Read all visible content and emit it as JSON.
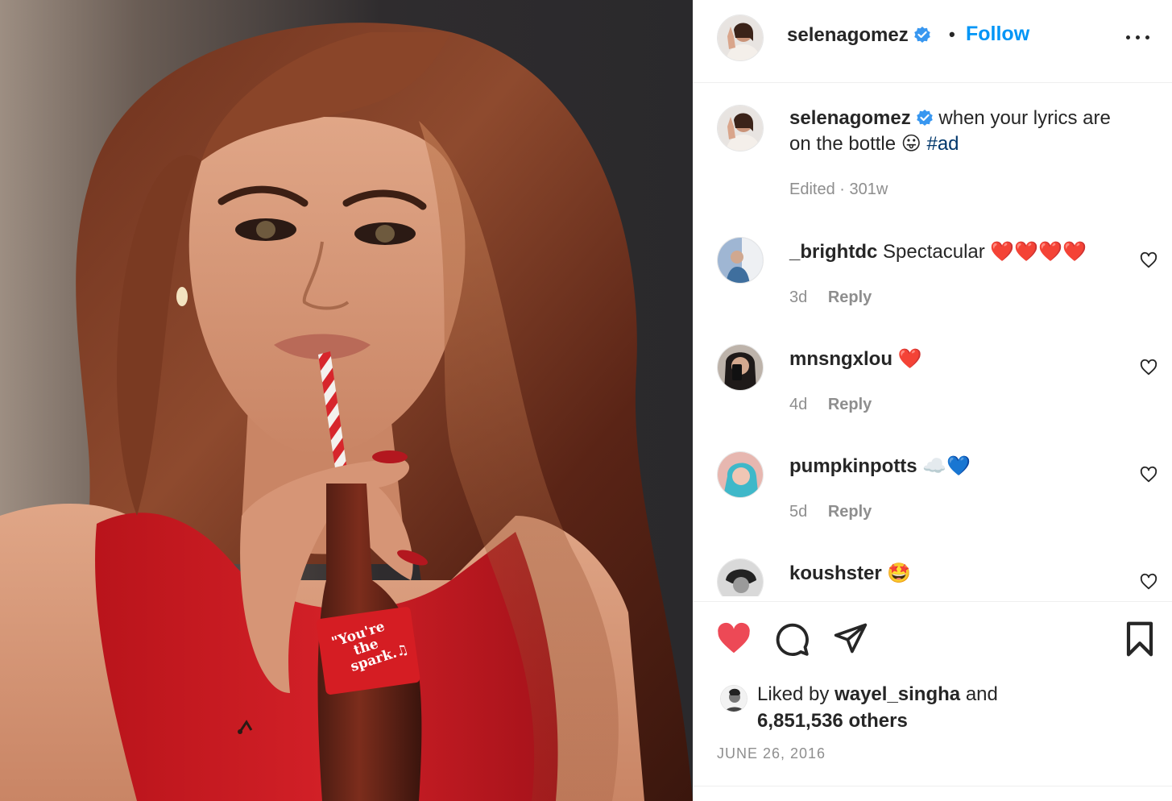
{
  "post": {
    "username": "selenagomez",
    "follow_label": "Follow",
    "separator": "•",
    "caption_text": "when your lyrics are on the bottle 😛",
    "caption_hashtag": "#ad",
    "edited_label": "Edited · 301w"
  },
  "photo": {
    "bottle_text": "\"You're the spark.\"",
    "bottle_line1": "\"You're",
    "bottle_line2": "the",
    "bottle_line3": "spark.♫"
  },
  "comments": [
    {
      "username": "_brightdc",
      "text": "Spectacular ❤️❤️❤️❤️",
      "age": "3d",
      "reply_label": "Reply"
    },
    {
      "username": "mnsngxlou",
      "text": "❤️",
      "age": "4d",
      "reply_label": "Reply"
    },
    {
      "username": "pumpkinpotts",
      "text": "☁️💙",
      "age": "5d",
      "reply_label": "Reply"
    },
    {
      "username": "koushster",
      "text": "🤩",
      "age": "",
      "reply_label": ""
    }
  ],
  "likes": {
    "prefix": "Liked by",
    "liker": "wayel_singha",
    "conjunction": "and",
    "count_text": "6,851,536 others"
  },
  "date": "JUNE 26, 2016",
  "colors": {
    "accent_blue": "#0095f6",
    "hashtag": "#00376b",
    "liked_heart": "#ed4956",
    "muted": "#8e8e8e",
    "text": "#262626"
  },
  "icons": {
    "liked": "heart-filled-icon",
    "comment": "comment-icon",
    "share": "send-icon",
    "save": "bookmark-icon",
    "more": "more-horizontal-icon",
    "verified": "verified-badge-icon"
  }
}
